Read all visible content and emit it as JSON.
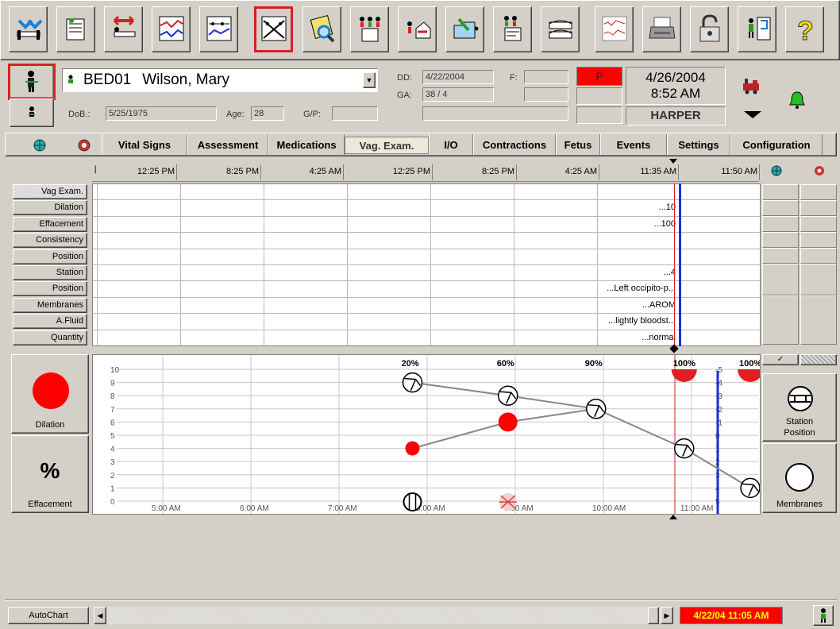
{
  "toolbar": {
    "buttons": [
      {
        "name": "bed-arrow-icon"
      },
      {
        "name": "patient-forms-icon"
      },
      {
        "name": "transfer-bed-icon"
      },
      {
        "name": "trend-graph-icon"
      },
      {
        "name": "flowsheet-graph-icon"
      },
      {
        "name": "partogram-icon"
      },
      {
        "name": "search-patient-icon"
      },
      {
        "name": "family-notes-icon"
      },
      {
        "name": "admit-home-icon"
      },
      {
        "name": "folder-transfer-icon"
      },
      {
        "name": "family-edit-icon"
      },
      {
        "name": "bed-list-icon"
      },
      {
        "name": "strip-chart-icon"
      },
      {
        "name": "printer-icon"
      },
      {
        "name": "unlock-icon"
      },
      {
        "name": "exit-door-icon"
      },
      {
        "name": "help-icon"
      }
    ]
  },
  "patient": {
    "bed": "BED01",
    "name": "Wilson, Mary",
    "dob_label": "DoB.:",
    "dob": "5/25/1975",
    "age_label": "Age:",
    "age": "28",
    "gp_label": "G/P:",
    "gp": "",
    "dd_label": "DD:",
    "dd": "4/22/2004",
    "ga_label": "GA:",
    "ga": "38 / 4",
    "f_label": "F:",
    "f": "",
    "status": "P",
    "date": "4/26/2004",
    "time": "8:52 AM",
    "user": "HARPER"
  },
  "tabs": [
    "Vital Signs",
    "Assessment",
    "Medications",
    "Vag. Exam.",
    "I/O",
    "Contractions",
    "Fetus",
    "Events",
    "Settings",
    "Configuration"
  ],
  "timeline": {
    "ticks": [
      "12:25 PM",
      "8:25 PM",
      "4:25 AM",
      "12:25 PM",
      "8:25 PM",
      "4:25 AM",
      "11:35 AM",
      "11:50 AM"
    ]
  },
  "rows": [
    "Vag Exam.",
    "Dilation",
    "Effacement",
    "Consistency",
    "Position",
    "Station",
    "Position",
    "Membranes",
    "A.Fluid",
    "Quantity"
  ],
  "row_values": [
    "",
    "...10",
    "...100",
    "",
    "",
    "...4",
    "...Left occipito-p...",
    "...AROM",
    "...lightly bloodst...",
    "...normal"
  ],
  "left_panel": {
    "dilation_label": "Dilation",
    "effacement_symbol": "%",
    "effacement_label": "Effacement"
  },
  "right_panel": {
    "station_label_1": "Station",
    "station_label_2": "Position",
    "membranes_label": "Membranes",
    "check": "✓"
  },
  "chart": {
    "y_left": [
      "10",
      "9",
      "8",
      "7",
      "6",
      "5",
      "4",
      "3",
      "2",
      "1",
      "0"
    ],
    "y_right": [
      "-5",
      "-4",
      "-3",
      "-2",
      "-1",
      "0",
      "1",
      "2",
      "3",
      "4",
      "5"
    ],
    "x_ticks": [
      "5:00 AM",
      "6:00 AM",
      "7:00 AM",
      "8:00 AM",
      "9:00 AM",
      "10:00 AM",
      "11:00 AM"
    ],
    "effacement_pct": [
      "20%",
      "60%",
      "90%",
      "100%",
      "100%"
    ]
  },
  "chart_data": {
    "type": "scatter",
    "series": [
      {
        "name": "Dilation",
        "x": [
          "7:50 AM",
          "8:55 AM",
          "9:55 AM",
          "10:55 AM",
          "11:40 AM"
        ],
        "values": [
          4,
          6,
          7,
          10,
          10
        ]
      },
      {
        "name": "Station",
        "x": [
          "7:50 AM",
          "8:55 AM",
          "9:55 AM",
          "10:55 AM",
          "11:40 AM"
        ],
        "values": [
          -4,
          -3,
          -2,
          1,
          4
        ]
      }
    ],
    "effacement": [
      "20%",
      "60%",
      "90%",
      "100%",
      "100%"
    ],
    "ylim": [
      0,
      10
    ]
  },
  "footer": {
    "autochart": "AutoChart",
    "datetime": "4/22/04 11:05 AM"
  },
  "colors": {
    "accent": "#d62020",
    "now_line": "#1a2fd6",
    "alarm_green": "#22c022"
  }
}
